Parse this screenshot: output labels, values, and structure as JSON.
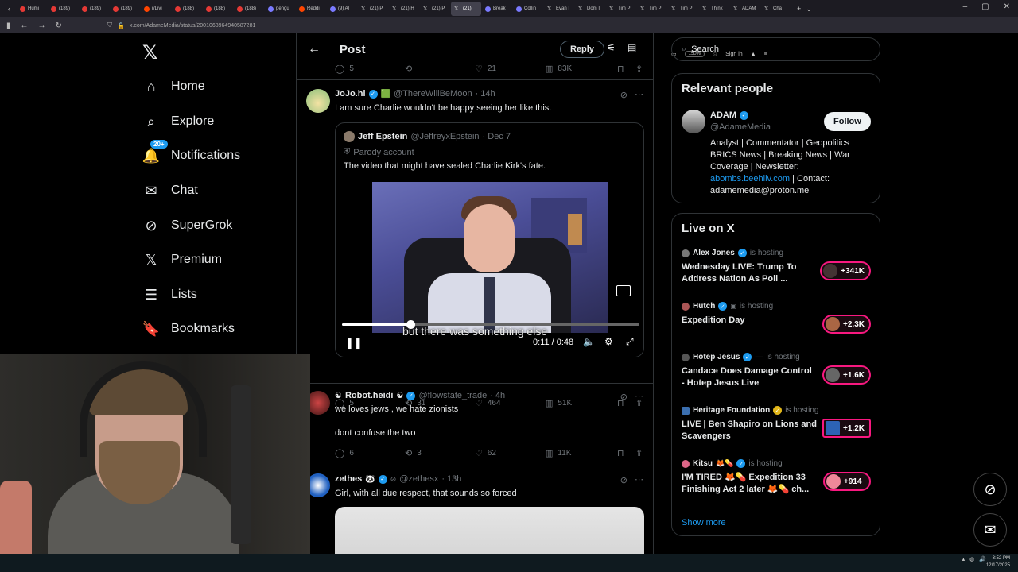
{
  "browser": {
    "tabs": [
      {
        "label": "Humi",
        "favicon": "youtube"
      },
      {
        "label": "(189)",
        "favicon": "youtube"
      },
      {
        "label": "(189)",
        "favicon": "youtube"
      },
      {
        "label": "(189)",
        "favicon": "youtube"
      },
      {
        "label": "r/Livi",
        "favicon": "reddit"
      },
      {
        "label": "(188)",
        "favicon": "youtube"
      },
      {
        "label": "(188)",
        "favicon": "youtube"
      },
      {
        "label": "(188)",
        "favicon": "youtube"
      },
      {
        "label": "pengu",
        "favicon": "web"
      },
      {
        "label": "Reddi",
        "favicon": "reddit"
      },
      {
        "label": "(9) Al",
        "favicon": "web"
      },
      {
        "label": "(21) P",
        "favicon": "x"
      },
      {
        "label": "(21) H",
        "favicon": "x"
      },
      {
        "label": "(21) P",
        "favicon": "x"
      },
      {
        "label": "(21)",
        "favicon": "x",
        "active": true
      },
      {
        "label": "Break",
        "favicon": "web"
      },
      {
        "label": "Collin",
        "favicon": "web"
      },
      {
        "label": "Evan I",
        "favicon": "x"
      },
      {
        "label": "Dom I",
        "favicon": "x"
      },
      {
        "label": "Tim P",
        "favicon": "x"
      },
      {
        "label": "Tim P",
        "favicon": "x"
      },
      {
        "label": "Tim P",
        "favicon": "x"
      },
      {
        "label": "Think",
        "favicon": "x"
      },
      {
        "label": "ADAM",
        "favicon": "x"
      },
      {
        "label": "Cha",
        "favicon": "x"
      }
    ],
    "url": "x.com/AdameMedia/status/2001068964940587281",
    "zoom": "150%",
    "signin": "Sign in"
  },
  "nav": {
    "items": [
      {
        "label": "Home",
        "icon": "home-icon"
      },
      {
        "label": "Explore",
        "icon": "search-icon"
      },
      {
        "label": "Notifications",
        "icon": "bell-icon",
        "badge": "20+"
      },
      {
        "label": "Chat",
        "icon": "mail-icon"
      },
      {
        "label": "SuperGrok",
        "icon": "grok-icon"
      },
      {
        "label": "Premium",
        "icon": "x-logo-icon"
      },
      {
        "label": "Lists",
        "icon": "list-icon"
      },
      {
        "label": "Bookmarks",
        "icon": "bookmark-icon"
      }
    ]
  },
  "header": {
    "title": "Post",
    "reply_label": "Reply"
  },
  "top_actions": {
    "replies": "5",
    "likes": "21",
    "views": "83K"
  },
  "tweet1": {
    "name": "JoJo.hl",
    "handle": "@ThereWillBeMoon",
    "time": "· 14h",
    "text": "I am sure Charlie wouldn't be happy seeing her like this.",
    "quote": {
      "name": "Jeff Epstein",
      "handle": "@JeffreyxEpstein",
      "time": "· Dec 7",
      "parody": "Parody account",
      "text": "The video that might have sealed Charlie Kirk's fate.",
      "caption": "but there was something else",
      "time_display": "0:11 / 0:48",
      "progress": 0.23
    },
    "replies": "5",
    "reposts": "31",
    "likes": "464",
    "views": "51K"
  },
  "tweet2": {
    "name": "Robot.heidi",
    "handle": "@flowstate_trade",
    "time": "· 4h",
    "line1": "we loves jews , we hate zionists",
    "line2": "dont confuse the two",
    "replies": "6",
    "reposts": "3",
    "likes": "62",
    "views": "11K"
  },
  "tweet3": {
    "name": "zethes",
    "handle": "@zethesx",
    "time": "· 13h",
    "text": "Girl, with all due respect, that sounds so forced"
  },
  "search": {
    "placeholder": "Search"
  },
  "relevant": {
    "title": "Relevant people",
    "name": "ADAM",
    "handle": "@AdameMedia",
    "follow": "Follow",
    "bio": "Analyst | Commentator | Geopolitics | BRICS News | Breaking News | War Coverage | Newsletter:",
    "link": "abombs.beehiiv.com",
    "contact": "| Contact: adamemedia@proton.me"
  },
  "live": {
    "title": "Live on X",
    "hosting_label": "is hosting",
    "items": [
      {
        "host": "Alex Jones",
        "title": "Wednesday LIVE: Trump To Address Nation As Poll ...",
        "count": "+341K"
      },
      {
        "host": "Hutch",
        "title": "Expedition Day",
        "count": "+2.3K"
      },
      {
        "host": "Hotep Jesus",
        "title": "Candace Does Damage Control - Hotep Jesus Live",
        "count": "+1.6K"
      },
      {
        "host": "Heritage Foundation",
        "title": "LIVE | Ben Shapiro on Lions and Scavengers",
        "count": "+1.2K"
      },
      {
        "host": "Kitsu",
        "title": "I'M TIRED 🦊💊 Expedition 33 Finishing Act 2 later 🦊💊 ch...",
        "count": "+914"
      }
    ],
    "show_more": "Show more"
  },
  "taskbar": {
    "time": "3:52 PM",
    "date": "12/17/2025"
  }
}
